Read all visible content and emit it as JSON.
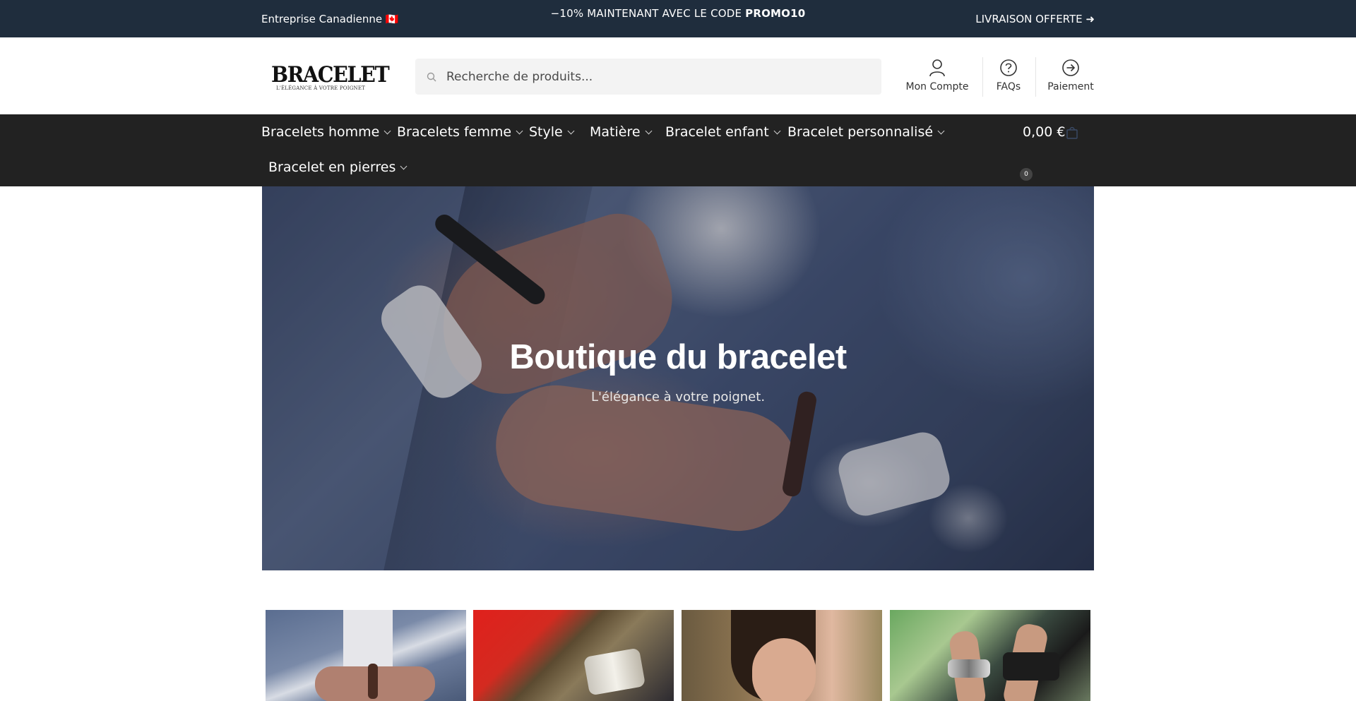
{
  "topbar": {
    "left": "Entreprise Canadienne 🇨🇦",
    "center_prefix": "−10% MAINTENANT AVEC LE CODE ",
    "center_code": "PROMO10",
    "right": "LIVRAISON OFFERTE ➜"
  },
  "header": {
    "logo_word": "BRACELET",
    "logo_tagline": "L'ÉLÉGANCE À VOTRE POIGNET",
    "search_placeholder": "Recherche de produits...",
    "account_label": "Mon Compte",
    "faqs_label": "FAQs",
    "payment_label": "Paiement"
  },
  "nav": {
    "items": [
      "Bracelets homme",
      "Bracelets femme",
      "Style",
      "Matière",
      "Bracelet enfant",
      "Bracelet personnalisé",
      "Bracelet en pierres"
    ],
    "cart_total": "0,00 €",
    "cart_count": "0"
  },
  "hero": {
    "title": "Boutique du bracelet",
    "subtitle": "L'élégance à votre poignet."
  },
  "colors": {
    "topbar_bg": "#1f2d3d",
    "nav_bg": "#222222"
  }
}
